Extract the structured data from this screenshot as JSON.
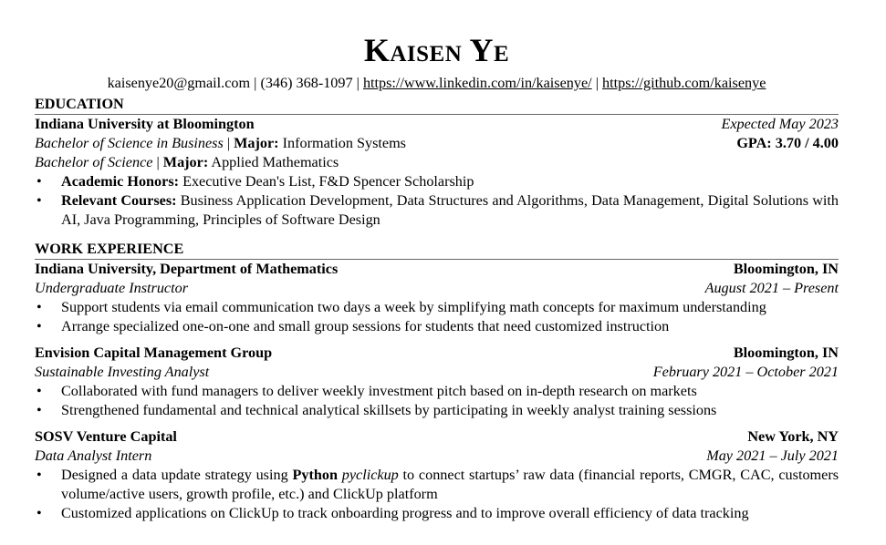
{
  "header": {
    "name": "Kaisen Ye",
    "email": "kaisenye20@gmail.com",
    "sep": " | ",
    "phone": "(346) 368-1097",
    "linkedin": "https://www.linkedin.com/in/kaisenye/",
    "github": "https://github.com/kaisenye"
  },
  "education": {
    "title": "EDUCATION",
    "school": "Indiana University at Bloomington",
    "date": "Expected May 2023",
    "degree1": "Bachelor of Science in Business",
    "degree_sep": " | ",
    "major_label": "Major:",
    "major1": " Information Systems",
    "gpa": "GPA: 3.70 / 4.00",
    "degree2": "Bachelor of Science",
    "major2": " Applied Mathematics",
    "honors_label": "Academic Honors:",
    "honors": " Executive Dean's List, F&D Spencer Scholarship",
    "courses_label": "Relevant Courses:",
    "courses": " Business Application Development, Data Structures and Algorithms, Data Management, Digital Solutions with AI, Java Programming, Principles of Software Design"
  },
  "work": {
    "title": "WORK EXPERIENCE",
    "jobs": [
      {
        "org": "Indiana University, Department of Mathematics",
        "location": "Bloomington, IN",
        "role": "Undergraduate Instructor",
        "dates": "August 2021 – Present",
        "bullets": [
          "Support students via email communication two days a week by simplifying math concepts for maximum understanding",
          "Arrange specialized one-on-one and small group sessions for students that need customized instruction"
        ]
      },
      {
        "org": "Envision Capital Management Group",
        "location": "Bloomington, IN",
        "role": "Sustainable Investing Analyst",
        "dates": "February 2021 – October 2021",
        "bullets": [
          "Collaborated with fund managers to deliver weekly investment pitch based on in-depth research on markets",
          "Strengthened fundamental and technical analytical skillsets by participating in weekly analyst training sessions"
        ]
      },
      {
        "org": "SOSV Venture Capital",
        "location": "New York, NY",
        "role": "Data Analyst Intern",
        "dates": "May 2021 – July 2021",
        "bullet1_pre": "Designed a data update strategy using ",
        "bullet1_bold": "Python",
        "bullet1_space": " ",
        "bullet1_italic": "pyclickup",
        "bullet1_post": " to connect startups’ raw data (financial reports, CMGR, CAC, customers volume/active users, growth profile, etc.) and ClickUp platform",
        "bullet2": "Customized applications on ClickUp to track onboarding progress and to improve overall efficiency of data tracking"
      }
    ]
  }
}
